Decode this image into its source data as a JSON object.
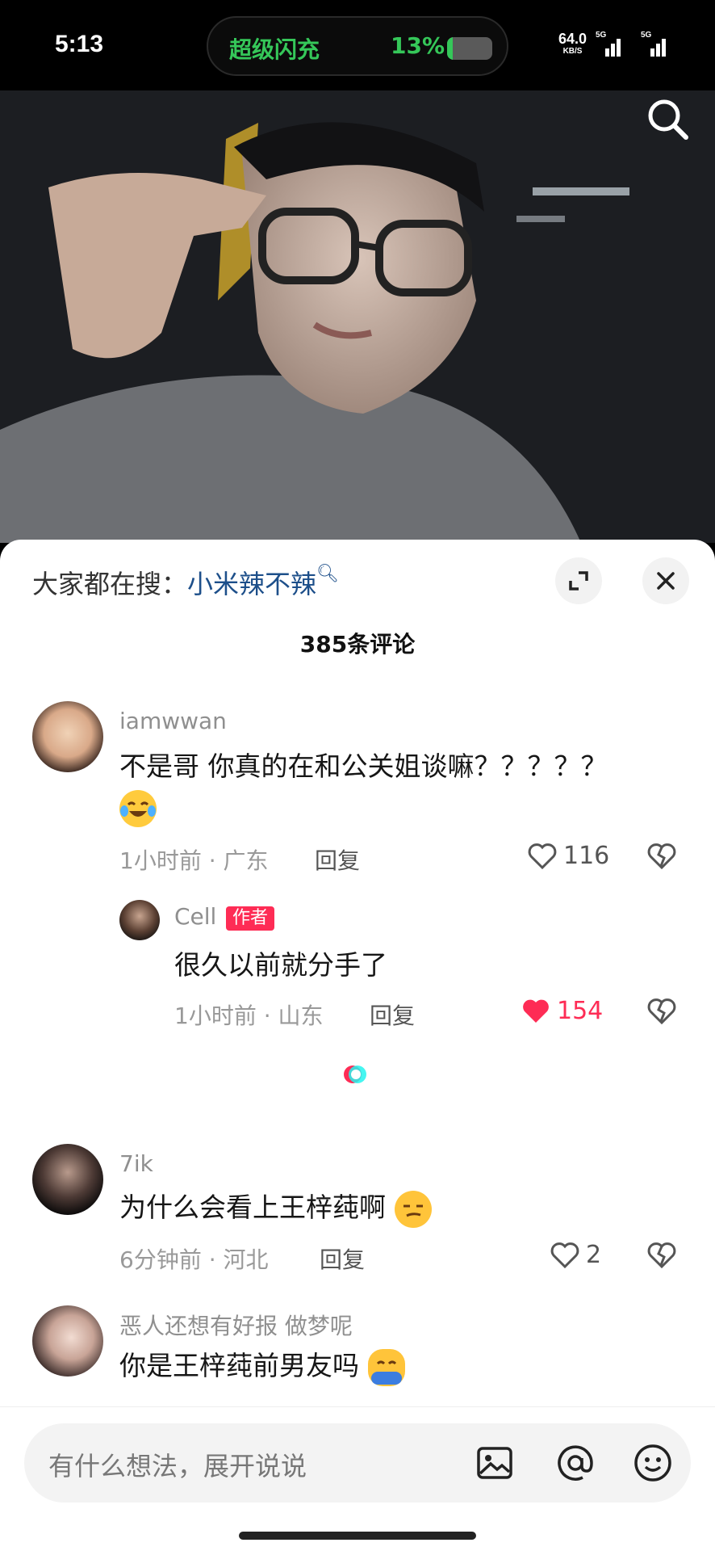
{
  "status_bar": {
    "time": "5:13",
    "charge_label": "超级闪充",
    "battery_percent": "13%",
    "battery_level": 0.13,
    "net_speed_value": "64.0",
    "net_speed_unit": "KB/S",
    "sim1_tag": "5G",
    "sim2_tag": "5G"
  },
  "video": {
    "search_icon": "search-icon"
  },
  "sheet": {
    "trending_prefix": "大家都在搜：",
    "trending_query": "小米辣不辣",
    "comment_count": "385条评论"
  },
  "comments": [
    {
      "username": "iamwwan",
      "text_line1": "不是哥 你真的在和公关姐谈嘛？？？？？",
      "text_line2_emoji": "crying-laughing-emoji",
      "meta": "1小时前 · 广东",
      "reply_label": "回复",
      "likes": "116",
      "liked": false,
      "replies": [
        {
          "username": "Cell",
          "badge": "作者",
          "text": "很久以前就分手了",
          "meta": "1小时前 · 山东",
          "reply_label": "回复",
          "likes": "154",
          "liked": true
        }
      ]
    },
    {
      "username": "7ik",
      "text": "为什么会看上王梓莼啊",
      "emoji": "smirk-emoji",
      "meta": "6分钟前 · 河北",
      "reply_label": "回复",
      "likes": "2",
      "liked": false
    },
    {
      "username": "恶人还想有好报 做梦呢",
      "text": "你是王梓莼前男友吗",
      "emoji": "hug-emoji"
    }
  ],
  "input_bar": {
    "placeholder": "有什么想法，展开说说",
    "icons": [
      "image-icon",
      "at-icon",
      "emoji-icon"
    ]
  },
  "colors": {
    "accent_red": "#fe2c55",
    "link_blue": "#1d4f8a",
    "charge_green": "#35c759"
  }
}
